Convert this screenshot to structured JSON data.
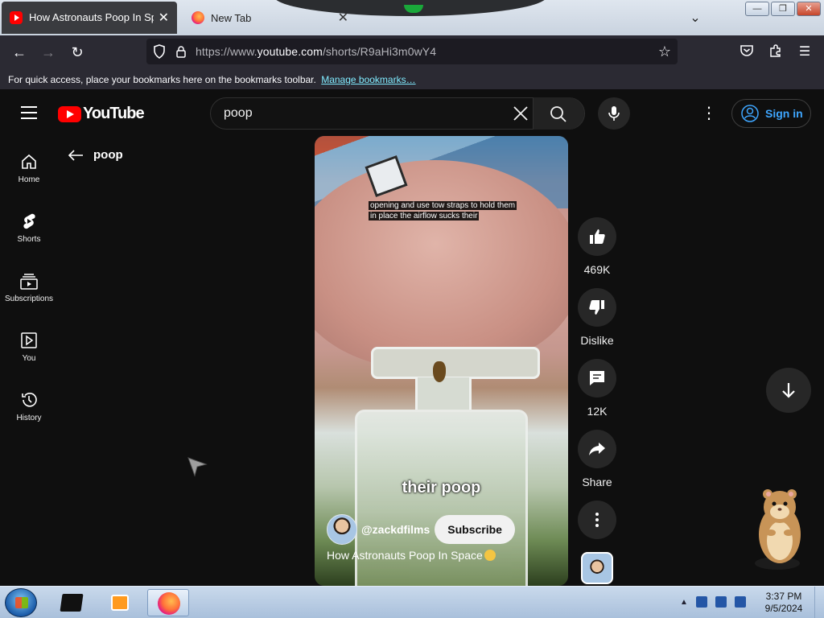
{
  "browser": {
    "tabs": [
      {
        "title": "How Astronauts Poop In Space 😨",
        "active": true
      },
      {
        "title": "New Tab",
        "active": false
      }
    ],
    "url_prefix": "https://www.",
    "url_domain": "youtube.com",
    "url_path": "/shorts/R9aHi3m0wY4",
    "bookmarks_message": "For quick access, place your bookmarks here on the bookmarks toolbar.",
    "bookmarks_link": "Manage bookmarks…",
    "window_buttons": {
      "minimize": "—",
      "restore": "❐",
      "close": "✕"
    }
  },
  "youtube": {
    "logo_text": "YouTube",
    "search_value": "poop",
    "sign_in": "Sign in",
    "sidebar": [
      {
        "label": "Home",
        "icon": "home-icon"
      },
      {
        "label": "Shorts",
        "icon": "shorts-icon"
      },
      {
        "label": "Subscriptions",
        "icon": "subscriptions-icon"
      },
      {
        "label": "You",
        "icon": "you-icon"
      },
      {
        "label": "History",
        "icon": "history-icon"
      }
    ],
    "back_label": "poop",
    "short": {
      "caption_line1": "opening and use tow straps to hold them",
      "caption_line2": "in place the airflow sucks their",
      "overlay_word": "their poop",
      "channel": "@zackdfilms",
      "subscribe": "Subscribe",
      "title": "How Astronauts Poop In Space"
    },
    "actions": {
      "likes": "469K",
      "dislike": "Dislike",
      "comments": "12K",
      "share": "Share"
    }
  },
  "taskbar": {
    "time": "3:37 PM",
    "date": "9/5/2024"
  },
  "colors": {
    "accent_link": "#3ea6ff",
    "youtube_red": "#ff0000",
    "background": "#0f0f0f"
  }
}
